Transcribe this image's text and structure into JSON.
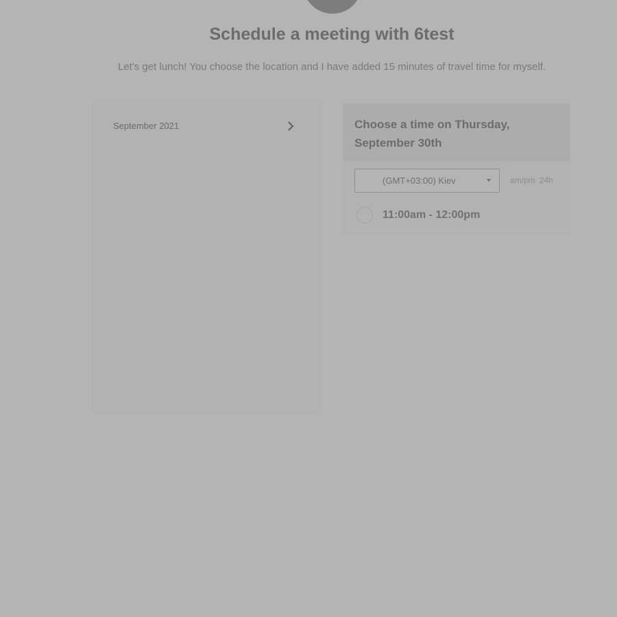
{
  "header": {
    "title": "Schedule a meeting with 6test",
    "description": "Let's get lunch! You choose the location and I have added 15 minutes of travel time for myself."
  },
  "calendar": {
    "month_label": "September 2021",
    "prev_icon": "chevron-left-icon",
    "next_icon": "chevron-right-icon"
  },
  "slots": {
    "title": "Choose a time on Thursday, September 30th",
    "timezone": {
      "selected": "(GMT+03:00) Kiev"
    },
    "time_format": {
      "ampm": "am/pm",
      "h24": "24h"
    },
    "items": [
      {
        "label": "11:00am - 12:00pm"
      }
    ]
  },
  "colors": {
    "overlay": "#b4b4b4",
    "title": "#6c6c6c",
    "text": "#7a7a7a"
  }
}
